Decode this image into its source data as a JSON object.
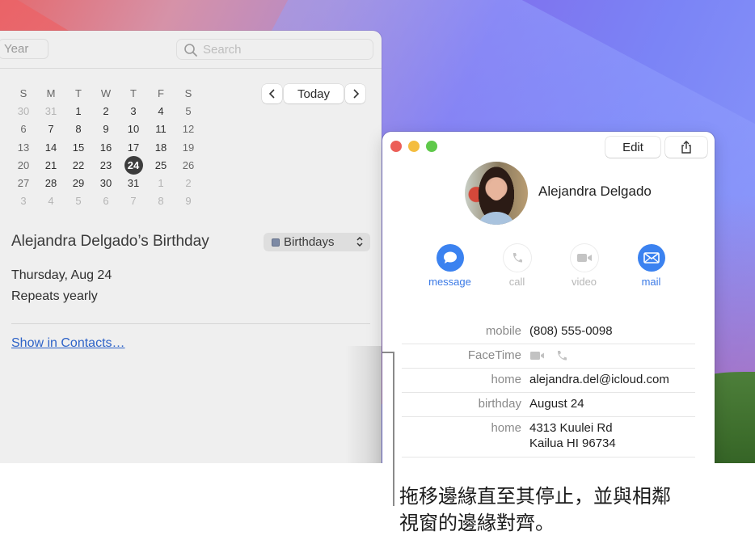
{
  "calendar": {
    "view_segment": "Year",
    "search_placeholder": "Search",
    "weekday_headers": [
      "S",
      "M",
      "T",
      "W",
      "T",
      "F",
      "S"
    ],
    "weeks": [
      [
        {
          "d": "30",
          "o": true
        },
        {
          "d": "31",
          "o": true
        },
        {
          "d": "1"
        },
        {
          "d": "2"
        },
        {
          "d": "3"
        },
        {
          "d": "4"
        },
        {
          "d": "5"
        }
      ],
      [
        {
          "d": "6"
        },
        {
          "d": "7"
        },
        {
          "d": "8"
        },
        {
          "d": "9"
        },
        {
          "d": "10"
        },
        {
          "d": "11"
        },
        {
          "d": "12"
        }
      ],
      [
        {
          "d": "13"
        },
        {
          "d": "14"
        },
        {
          "d": "15"
        },
        {
          "d": "16"
        },
        {
          "d": "17"
        },
        {
          "d": "18"
        },
        {
          "d": "19"
        }
      ],
      [
        {
          "d": "20"
        },
        {
          "d": "21"
        },
        {
          "d": "22"
        },
        {
          "d": "23"
        },
        {
          "d": "24",
          "sel": true
        },
        {
          "d": "25"
        },
        {
          "d": "26"
        }
      ],
      [
        {
          "d": "27"
        },
        {
          "d": "28"
        },
        {
          "d": "29"
        },
        {
          "d": "30"
        },
        {
          "d": "31"
        },
        {
          "d": "1",
          "o": true
        },
        {
          "d": "2",
          "o": true
        }
      ],
      [
        {
          "d": "3",
          "o": true
        },
        {
          "d": "4",
          "o": true
        },
        {
          "d": "5",
          "o": true
        },
        {
          "d": "6",
          "o": true
        },
        {
          "d": "7",
          "o": true
        },
        {
          "d": "8",
          "o": true
        },
        {
          "d": "9",
          "o": true
        }
      ]
    ],
    "prev_label": "<",
    "today_label": "Today",
    "next_label": ">",
    "event": {
      "title": "Alejandra Delgado’s Birthday",
      "calendar_name": "Birthdays",
      "calendar_color": "#7d8aa5",
      "date": "Thursday, Aug 24",
      "repeat": "Repeats yearly",
      "link": "Show in Contacts…"
    }
  },
  "contact": {
    "edit_label": "Edit",
    "share_icon": "share-icon",
    "name": "Alejandra Delgado",
    "accent_color": "#3b82f0",
    "actions": [
      {
        "label": "message",
        "icon": "message-icon",
        "enabled": true
      },
      {
        "label": "call",
        "icon": "phone-icon",
        "enabled": false
      },
      {
        "label": "video",
        "icon": "video-icon",
        "enabled": false
      },
      {
        "label": "mail",
        "icon": "mail-icon",
        "enabled": true
      }
    ],
    "fields": [
      {
        "label": "mobile",
        "value": "(808) 555-0098"
      },
      {
        "label": "FaceTime",
        "value": ""
      },
      {
        "label": "home",
        "value": "alejandra.del@icloud.com"
      },
      {
        "label": "birthday",
        "value": "August 24"
      },
      {
        "label": "home",
        "value": "4313 Kuulei Rd",
        "value2": "Kailua HI 96734"
      }
    ]
  },
  "callout": {
    "line1": "拖移邊緣直至其停止，並與相鄰",
    "line2": "視窗的邊緣對齊。"
  }
}
